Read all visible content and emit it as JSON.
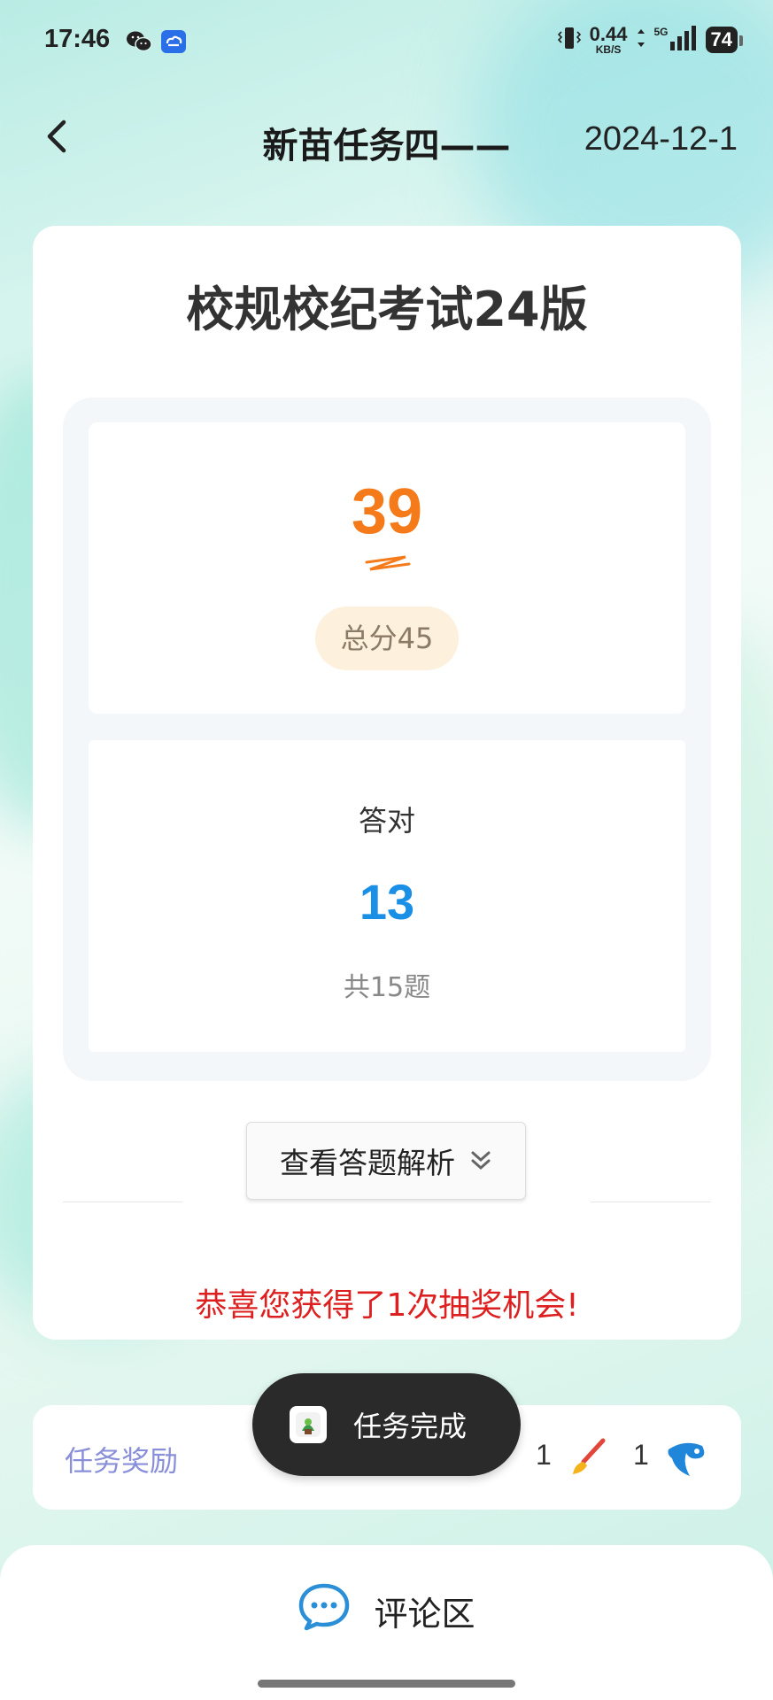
{
  "status_bar": {
    "time": "17:46",
    "net_speed": "0.44",
    "net_unit": "KB/S",
    "network": "5G",
    "battery": "74"
  },
  "header": {
    "title": "新苗任务四——",
    "date": "2024-12-1"
  },
  "exam": {
    "title": "校规校纪考试24版",
    "score": "39",
    "total_score": "总分45",
    "correct_label": "答对",
    "correct_count": "13",
    "question_total": "共15题",
    "view_analysis": "查看答题解析",
    "congrats": "恭喜您获得了1次抽奖机会!"
  },
  "rewards": {
    "label": "任务奖励",
    "items": [
      {
        "count": "1",
        "icon": "paintbrush-icon"
      },
      {
        "count": "1",
        "icon": "water-drop-icon"
      }
    ]
  },
  "toast": {
    "text": "任务完成",
    "icon": "app-icon"
  },
  "comment": {
    "label": "评论区",
    "icon": "chat-bubble-icon"
  },
  "colors": {
    "score": "#f47a1a",
    "correct": "#1a8fe6",
    "congrats": "#dd1f1f",
    "reward_label": "#8a8fd9"
  }
}
